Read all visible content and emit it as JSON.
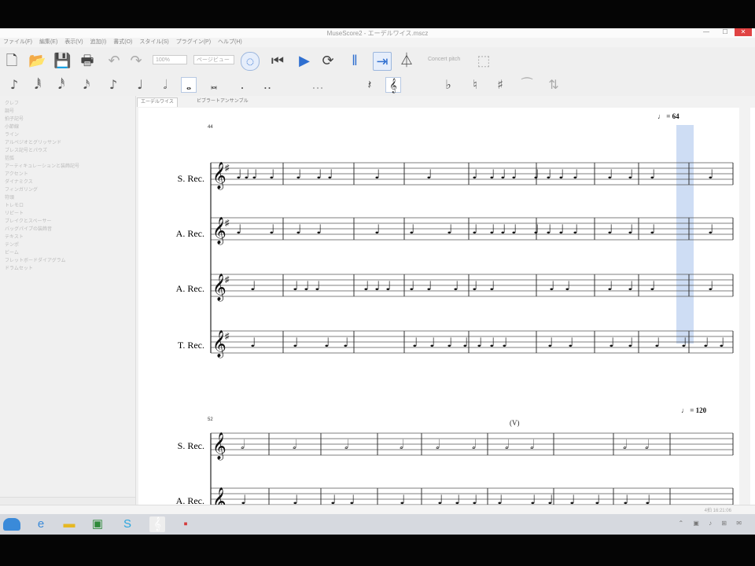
{
  "window": {
    "title": "MuseScore2 - エーデルワイス.mscz",
    "controls": {
      "minimize": "—",
      "maximize": "☐",
      "close": "✕"
    }
  },
  "menu": [
    "ファイル(F)",
    "編集(E)",
    "表示(V)",
    "追加(I)",
    "書式(O)",
    "スタイル(S)",
    "プラグイン(P)",
    "ヘルプ(H)"
  ],
  "toolbar": {
    "zoom_value": "100%",
    "view_mode": "ページビュー",
    "concert_pitch": "Concert pitch",
    "icons": [
      "new-icon",
      "open-icon",
      "save-icon",
      "print-icon",
      "undo-icon",
      "redo-icon",
      "note-input-icon",
      "rewind-icon",
      "play-icon",
      "loop-icon",
      "repeat-icon",
      "pan-icon",
      "metronome-icon",
      "image-capture-icon"
    ]
  },
  "note_toolbar": [
    "♪",
    "𝅘𝅥𝅱",
    "𝅘𝅥𝅰",
    "𝅘𝅥𝅯",
    "♪",
    "♩",
    "𝅗𝅥",
    "𝅝",
    "𝅜",
    ".",
    "..",
    "...",
    "𝄽",
    "♭",
    "♮",
    "♯"
  ],
  "sidebar": {
    "items": [
      "クレフ",
      "調号",
      "拍子記号",
      "小節線",
      "ライン",
      "アルペジオとグリッサンド",
      "ブレス記号とパウズ",
      "括弧",
      "アーティキュレーションと装飾記号",
      "アクセント",
      "ダイナミクス",
      "フィンガリング",
      "符頭",
      "トレモロ",
      "リピート",
      "ブレイクとスペーサー",
      "バッグパイプの装飾音",
      "テキスト",
      "テンポ",
      "ビーム",
      "フレットボードダイアグラム",
      "ドラムセット"
    ]
  },
  "tabs": [
    "エーデルワイス",
    "ビブラートアンサンブル"
  ],
  "score": {
    "system1": {
      "measure_number": "44",
      "tempo_text": "= 64",
      "instruments": [
        "S. Rec.",
        "A. Rec.",
        "A. Rec.",
        "T. Rec."
      ]
    },
    "system2": {
      "measure_number": "52",
      "tempo_text": "= 120",
      "breath_mark": "(V)",
      "instruments": [
        "S. Rec.",
        "A. Rec."
      ]
    }
  },
  "statusbar": {
    "right": "4拍 16:21:06"
  },
  "taskbar": {
    "apps": [
      "explorer",
      "internet-explorer",
      "file-explorer",
      "excel",
      "skype",
      "musescore",
      "media-player"
    ],
    "tray": "⌃ ▣ ♪ ⊞ ✉"
  }
}
